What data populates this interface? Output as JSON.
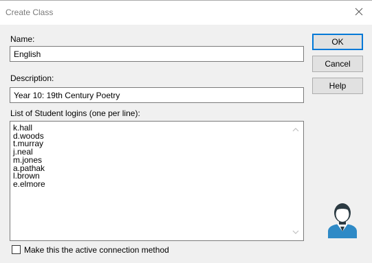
{
  "dialog": {
    "title": "Create Class",
    "close_icon": "close-icon"
  },
  "form": {
    "name_label": "Name:",
    "name_value": "English",
    "description_label": "Description:",
    "description_value": "Year 10: 19th Century Poetry",
    "students_label": "List of Student logins (one per line):",
    "students": [
      "k.hall",
      "d.woods",
      "t.murray",
      "j.neal",
      "m.jones",
      "a.pathak",
      "l.brown",
      "e.elmore"
    ],
    "active_checkbox_label": "Make this the active connection method",
    "active_checkbox_checked": false
  },
  "buttons": {
    "ok": "OK",
    "cancel": "Cancel",
    "help": "Help"
  },
  "icons": {
    "avatar": "user-avatar-icon",
    "scroll_up": "scroll-up-arrow-icon",
    "scroll_down": "scroll-down-arrow-icon"
  },
  "colors": {
    "accent": "#0078d7",
    "avatar_blue": "#2f8ac6",
    "avatar_dark": "#2b3a42"
  }
}
